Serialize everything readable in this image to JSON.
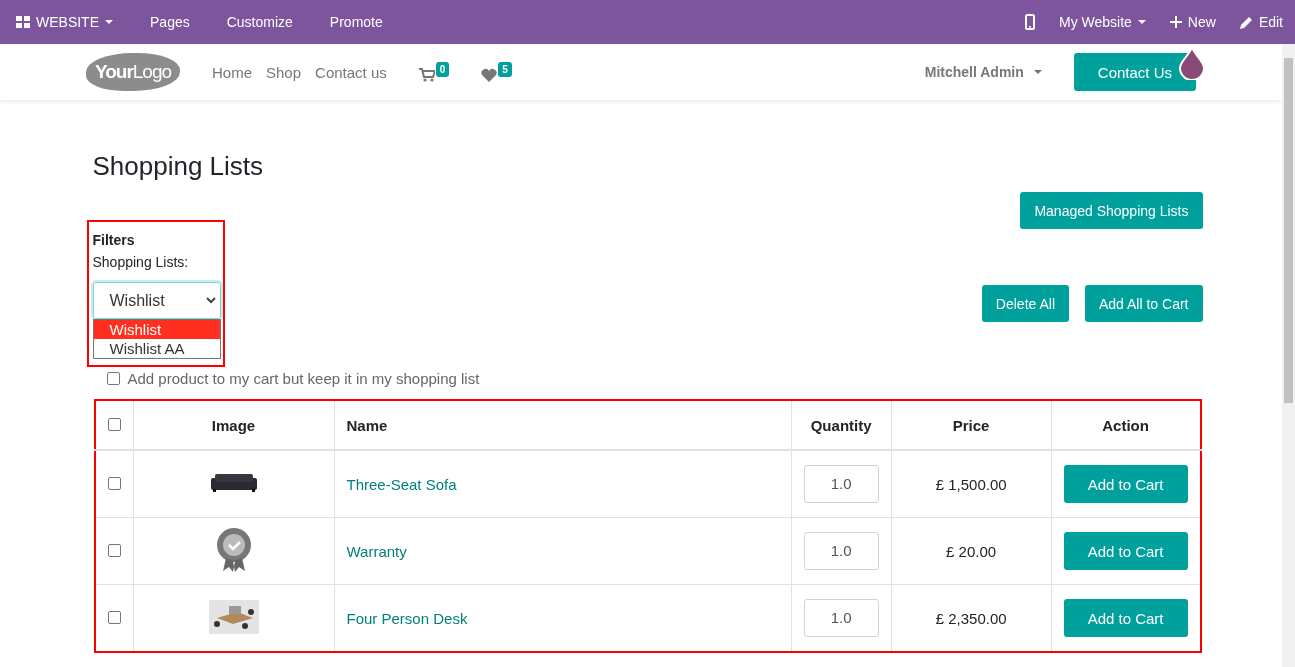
{
  "admin_bar": {
    "left": [
      {
        "label": "WEBSITE",
        "kind": "apps"
      },
      {
        "label": "Pages",
        "kind": "plain"
      },
      {
        "label": "Customize",
        "kind": "plain"
      },
      {
        "label": "Promote",
        "kind": "plain"
      }
    ],
    "right": [
      {
        "kind": "mobile"
      },
      {
        "label": "My Website",
        "kind": "caret"
      },
      {
        "label": "New",
        "kind": "plus"
      },
      {
        "label": "Edit",
        "kind": "pencil"
      }
    ]
  },
  "header": {
    "logo": "**Your**Logo",
    "nav": [
      "Home",
      "Shop",
      "Contact us"
    ],
    "cart_count": "0",
    "wishlist_count": "5",
    "user": "Mitchell Admin",
    "contact_button": "Contact Us"
  },
  "page": {
    "title": "Shopping Lists",
    "manage_button": "Managed Shopping Lists",
    "filters": {
      "heading": "Filters",
      "label": "Shopping Lists:",
      "value": "Wishlist",
      "options": [
        {
          "label": "Wishlist",
          "selected": true
        },
        {
          "label": "Wishlist AA",
          "selected": false
        }
      ]
    },
    "buttons": [
      "Delete All",
      "Add All to Cart"
    ],
    "keep_option": {
      "label": "Add product to my cart but keep it in my shopping list",
      "checked": false
    },
    "table": {
      "columns": [
        "Image",
        "Name",
        "Quantity",
        "Price",
        "Action"
      ],
      "all_checked": false,
      "rows": [
        {
          "checked": false,
          "name": "Three-Seat Sofa",
          "quantity": "1.0",
          "price": "£ 1,500.00",
          "action": "Add to Cart"
        },
        {
          "checked": false,
          "name": "Warranty",
          "quantity": "1.0",
          "price": "£ 20.00",
          "action": "Add to Cart"
        },
        {
          "checked": false,
          "name": "Four Person Desk",
          "quantity": "1.0",
          "price": "£ 2,350.00",
          "action": "Add to Cart"
        }
      ]
    }
  }
}
